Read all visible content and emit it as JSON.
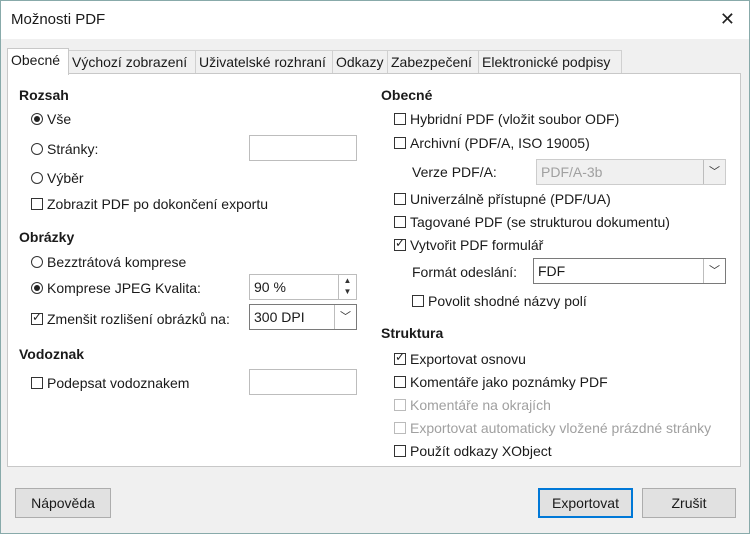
{
  "title": "Možnosti PDF",
  "tabs": [
    "Obecné",
    "Výchozí zobrazení",
    "Uživatelské rozhraní",
    "Odkazy",
    "Zabezpečení",
    "Elektronické podpisy"
  ],
  "rozsah": {
    "header": "Rozsah",
    "vse": "Vše",
    "stranky": "Stránky:",
    "stranky_value": "",
    "vyber": "Výběr",
    "zobrazit": "Zobrazit PDF po dokončení exportu"
  },
  "obrazky": {
    "header": "Obrázky",
    "bezztratova": "Bezztrátová komprese",
    "jpeg": "Komprese JPEG",
    "kvalita": "Kvalita:",
    "kvalita_value": "90 %",
    "zmensit": "Zmenšit rozlišení obrázků na:",
    "dpi_value": "300 DPI"
  },
  "vodoznak": {
    "header": "Vodoznak",
    "podepsat": "Podepsat vodoznakem",
    "value": ""
  },
  "obecne": {
    "header": "Obecné",
    "hybridni": "Hybridní PDF (vložit soubor ODF)",
    "archivni": "Archivní (PDF/A, ISO 19005)",
    "verze_label": "Verze PDF/A:",
    "verze_value": "PDF/A-3b",
    "univerzalne": "Univerzálně přístupné (PDF/UA)",
    "tagovane": "Tagované PDF (se strukturou dokumentu)",
    "formular": "Vytvořit PDF formulář",
    "format_label": "Formát odeslání:",
    "format_value": "FDF",
    "povolit": "Povolit shodné názvy polí"
  },
  "struktura": {
    "header": "Struktura",
    "exportovat_osnovu": "Exportovat osnovu",
    "komentare_poznamky": "Komentáře jako poznámky PDF",
    "komentare_okraje": "Komentáře na okrajích",
    "exportovat_prazdne": "Exportovat automaticky vložené prázdné stránky",
    "xobject": "Použít odkazy XObject"
  },
  "buttons": {
    "help": "Nápověda",
    "export": "Exportovat",
    "cancel": "Zrušit"
  }
}
